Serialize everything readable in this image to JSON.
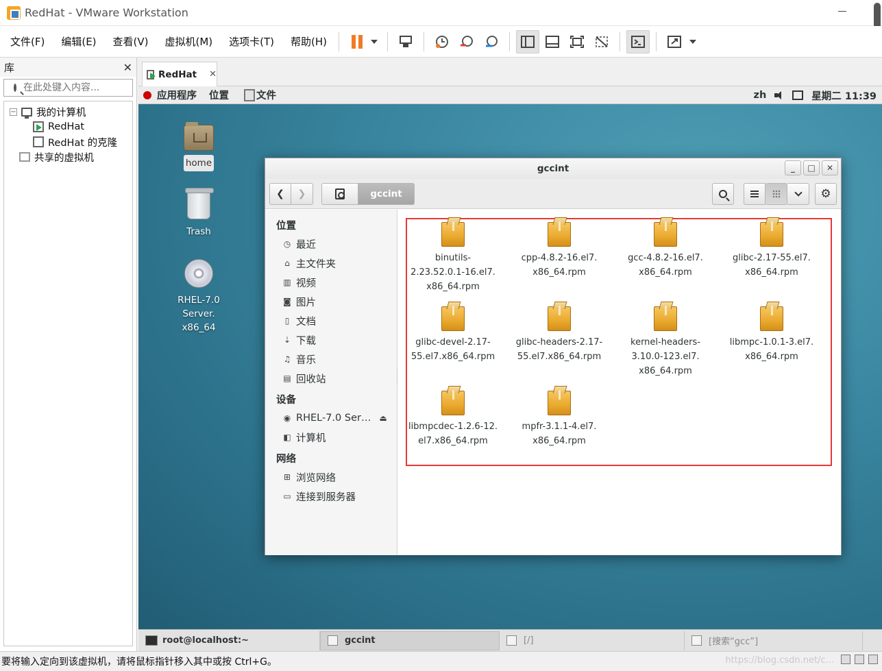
{
  "window": {
    "title": "RedHat - VMware Workstation"
  },
  "menu": [
    "文件(F)",
    "编辑(E)",
    "查看(V)",
    "虚拟机(M)",
    "选项卡(T)",
    "帮助(H)"
  ],
  "library": {
    "title": "库",
    "search_placeholder": "在此处键入内容...",
    "tree": {
      "root": "我的计算机",
      "vms": [
        "RedHat",
        "RedHat 的克隆"
      ],
      "shared": "共享的虚拟机"
    }
  },
  "vm_tab": {
    "label": "RedHat"
  },
  "guest": {
    "topbar": {
      "apps": "应用程序",
      "places": "位置",
      "files": "文件",
      "lang": "zh",
      "clock": "星期二 11:39"
    },
    "desktop": {
      "home": "home",
      "trash": "Trash",
      "dvd": "RHEL-7.0 Server.\nx86_64"
    },
    "nautilus": {
      "title": "gccint",
      "path_current": "gccint",
      "sidebar": {
        "places_header": "位置",
        "places": [
          "最近",
          "主文件夹",
          "视频",
          "图片",
          "文档",
          "下载",
          "音乐",
          "回收站"
        ],
        "devices_header": "设备",
        "devices": [
          "RHEL-7.0 Ser…",
          "计算机"
        ],
        "network_header": "网络",
        "network": [
          "浏览网络",
          "连接到服务器"
        ]
      },
      "files": [
        "binutils-\n2.23.52.0.1-16.el7.\nx86_64.rpm",
        "cpp-4.8.2-16.el7.\nx86_64.rpm",
        "gcc-4.8.2-16.el7.\nx86_64.rpm",
        "glibc-2.17-55.el7.\nx86_64.rpm",
        "glibc-devel-2.17-\n55.el7.x86_64.rpm",
        "glibc-headers-2.17-\n55.el7.x86_64.rpm",
        "kernel-headers-\n3.10.0-123.el7.\nx86_64.rpm",
        "libmpc-1.0.1-3.el7.\nx86_64.rpm",
        "libmpcdec-1.2.6-12.\nel7.x86_64.rpm",
        "mpfr-3.1.1-4.el7.\nx86_64.rpm"
      ]
    },
    "taskbar": [
      "root@localhost:~",
      "gccint",
      "[/]",
      "[搜索“gcc”]"
    ]
  },
  "status": {
    "message": "要将输入定向到该虚拟机，请将鼠标指针移入其中或按 Ctrl+G。",
    "watermark": "https://blog.csdn.net/c..."
  },
  "colors": {
    "accent_pause": "#f07b27",
    "highlight_frame": "#e53935",
    "desktop": "#3a86a0"
  }
}
